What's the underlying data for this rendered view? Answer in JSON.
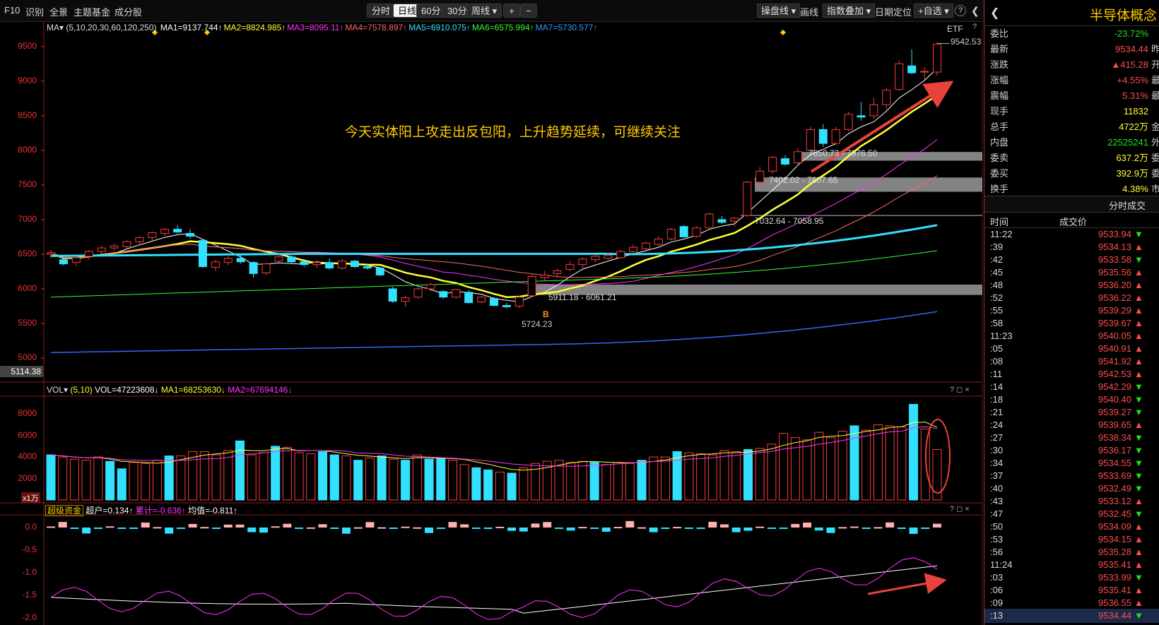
{
  "toolbar": {
    "left": [
      "F10",
      "识别",
      "全景",
      "主题基金",
      "成分股"
    ],
    "periods": [
      "分时",
      "日线",
      "60分",
      "30分",
      "周线 ▾"
    ],
    "active_period": "日线",
    "zoom_in": "+",
    "zoom_out": "−",
    "right": [
      "操盘线 ▾",
      "画线",
      "指数叠加 ▾",
      "日期定位",
      "+自选 ▾"
    ],
    "help": "?",
    "collapse": "❮"
  },
  "main_chart": {
    "ma_title": "MA▾",
    "ma_params": "(5,10,20,30,60,120,250)",
    "ma_values": [
      {
        "text": "MA1=9137.744↑",
        "color": "#ffffff"
      },
      {
        "text": "MA2=8824.985↑",
        "color": "#ffff33"
      },
      {
        "text": "MA3=8095.11↑",
        "color": "#ff33ff"
      },
      {
        "text": "MA4=7578.897↑",
        "color": "#ff6666"
      },
      {
        "text": "MA5=6910.075↑",
        "color": "#33e0ff"
      },
      {
        "text": "MA6=6575.994↑",
        "color": "#33ff33"
      },
      {
        "text": "MA7=5730.577↑",
        "color": "#3399ff"
      }
    ],
    "etf_label": "ETF",
    "help": "?",
    "y_ticks": [
      "9500",
      "9000",
      "8500",
      "8000",
      "7500",
      "7000",
      "6500",
      "6000",
      "5500",
      "5000"
    ],
    "current_price_tag": "5114.38",
    "high_label": "9542.53",
    "low_label": "5724.23",
    "buy_marker": "B",
    "annotation": "今天实体阳上攻走出反包阳，上升趋势延续，可继续关注",
    "zones": [
      {
        "label": "7850.73 - 7976.50"
      },
      {
        "label": "7402.02 - 7607.65"
      },
      {
        "label": "7032.64 - 7058.95"
      },
      {
        "label": "5911.18 - 6061.21"
      }
    ]
  },
  "vol_chart": {
    "title": "VOL▾",
    "params": "(5,10)",
    "vol_value": {
      "text": "VOL=47223608↓",
      "color": "#ffffff"
    },
    "ma1": {
      "text": "MA1=68253630↓",
      "color": "#ffff33"
    },
    "ma2": {
      "text": "MA2=67694146↓",
      "color": "#ff33ff"
    },
    "y_ticks": [
      "8000",
      "6000",
      "4000",
      "2000"
    ],
    "unit": "x1万",
    "controls": "? ◻ ×"
  },
  "fund_chart": {
    "title": "超级资金",
    "v1": {
      "text": "超户=0.134↑",
      "color": "#ffffff"
    },
    "v2": {
      "text": "累计=-0.636↑",
      "color": "#ff33ff"
    },
    "v3": {
      "text": "均值=-0.811↑",
      "color": "#ffffff"
    },
    "y_ticks": [
      "0.0",
      "-0.5",
      "-1.0",
      "-1.5",
      "-2.0"
    ],
    "controls": "? ◻ ×"
  },
  "side": {
    "title": "半导体概念",
    "quotes": [
      {
        "label": "委比",
        "value": "-23.72%",
        "color": "#20e020",
        "extra": ""
      },
      {
        "label": "最新",
        "value": "9534.44",
        "color": "#ff4d4d",
        "extra": "昨"
      },
      {
        "label": "涨跌",
        "value": "▲415.28",
        "color": "#ff4d4d",
        "extra": "开"
      },
      {
        "label": "涨幅",
        "value": "+4.55%",
        "color": "#ff4d4d",
        "extra": "最"
      },
      {
        "label": "震幅",
        "value": "5.31%",
        "color": "#ff4d4d",
        "extra": "最"
      },
      {
        "label": "现手",
        "value": "11832",
        "color": "#ffff33",
        "extra": ""
      },
      {
        "label": "总手",
        "value": "4722万",
        "color": "#ffff33",
        "extra": "金"
      },
      {
        "label": "内盘",
        "value": "22525241",
        "color": "#20e020",
        "extra": "外"
      },
      {
        "label": "委卖",
        "value": "637.2万",
        "color": "#ffff33",
        "extra": "委"
      },
      {
        "label": "委买",
        "value": "392.9万",
        "color": "#ffff33",
        "extra": "委"
      },
      {
        "label": "换手",
        "value": "4.38%",
        "color": "#ffff33",
        "extra": "市"
      }
    ],
    "trades_title": "分时成交",
    "trade_headers": [
      "时间",
      "成交价"
    ],
    "trades": [
      {
        "t": "11:22",
        "p": "9533.94",
        "d": "▼"
      },
      {
        "t": ":39",
        "p": "9534.13",
        "d": "▲"
      },
      {
        "t": ":42",
        "p": "9533.58",
        "d": "▼"
      },
      {
        "t": ":45",
        "p": "9535.56",
        "d": "▲"
      },
      {
        "t": ":48",
        "p": "9536.20",
        "d": "▲"
      },
      {
        "t": ":52",
        "p": "9536.22",
        "d": "▲"
      },
      {
        "t": ":55",
        "p": "9539.29",
        "d": "▲"
      },
      {
        "t": ":58",
        "p": "9539.67",
        "d": "▲"
      },
      {
        "t": "11:23",
        "p": "9540.05",
        "d": "▲"
      },
      {
        "t": ":05",
        "p": "9540.91",
        "d": "▲"
      },
      {
        "t": ":08",
        "p": "9541.92",
        "d": "▲"
      },
      {
        "t": ":11",
        "p": "9542.53",
        "d": "▲"
      },
      {
        "t": ":14",
        "p": "9542.29",
        "d": "▼"
      },
      {
        "t": ":18",
        "p": "9540.40",
        "d": "▼"
      },
      {
        "t": ":21",
        "p": "9539.27",
        "d": "▼"
      },
      {
        "t": ":24",
        "p": "9539.65",
        "d": "▲"
      },
      {
        "t": ":27",
        "p": "9538.34",
        "d": "▼"
      },
      {
        "t": ":30",
        "p": "9536.17",
        "d": "▼"
      },
      {
        "t": ":34",
        "p": "9534.55",
        "d": "▼"
      },
      {
        "t": ":37",
        "p": "9533.69",
        "d": "▼"
      },
      {
        "t": ":40",
        "p": "9532.49",
        "d": "▼"
      },
      {
        "t": ":43",
        "p": "9533.12",
        "d": "▲"
      },
      {
        "t": ":47",
        "p": "9532.45",
        "d": "▼"
      },
      {
        "t": ":50",
        "p": "9534.09",
        "d": "▲"
      },
      {
        "t": ":53",
        "p": "9534.15",
        "d": "▲"
      },
      {
        "t": ":56",
        "p": "9535.28",
        "d": "▲"
      },
      {
        "t": "11:24",
        "p": "9535.41",
        "d": "▲"
      },
      {
        "t": ":03",
        "p": "9533.99",
        "d": "▼"
      },
      {
        "t": ":06",
        "p": "9535.41",
        "d": "▲"
      },
      {
        "t": ":09",
        "p": "9536.55",
        "d": "▲"
      },
      {
        "t": ":13",
        "p": "9534.44",
        "d": "▼"
      }
    ]
  },
  "chart_data": {
    "type": "candlestick",
    "candles": [
      [
        6500,
        6560,
        6440,
        6520,
        "up"
      ],
      [
        6420,
        6480,
        6340,
        6360,
        "dn"
      ],
      [
        6380,
        6460,
        6330,
        6450,
        "up"
      ],
      [
        6470,
        6560,
        6420,
        6540,
        "up"
      ],
      [
        6540,
        6620,
        6500,
        6590,
        "up"
      ],
      [
        6590,
        6650,
        6550,
        6620,
        "up"
      ],
      [
        6610,
        6700,
        6580,
        6680,
        "up"
      ],
      [
        6680,
        6760,
        6640,
        6740,
        "up"
      ],
      [
        6740,
        6830,
        6700,
        6810,
        "up"
      ],
      [
        6800,
        6880,
        6760,
        6860,
        "up"
      ],
      [
        6860,
        6920,
        6800,
        6820,
        "dn"
      ],
      [
        6800,
        6860,
        6720,
        6760,
        "dn"
      ],
      [
        6700,
        6720,
        6300,
        6320,
        "dn"
      ],
      [
        6310,
        6420,
        6260,
        6390,
        "up"
      ],
      [
        6380,
        6470,
        6340,
        6440,
        "up"
      ],
      [
        6440,
        6500,
        6360,
        6390,
        "dn"
      ],
      [
        6380,
        6400,
        6160,
        6220,
        "dn"
      ],
      [
        6230,
        6380,
        6200,
        6360,
        "up"
      ],
      [
        6400,
        6500,
        6380,
        6460,
        "up"
      ],
      [
        6460,
        6480,
        6360,
        6390,
        "dn"
      ],
      [
        6390,
        6430,
        6320,
        6350,
        "dn"
      ],
      [
        6350,
        6420,
        6300,
        6380,
        "up"
      ],
      [
        6380,
        6440,
        6280,
        6300,
        "dn"
      ],
      [
        6300,
        6440,
        6280,
        6400,
        "up"
      ],
      [
        6400,
        6420,
        6300,
        6320,
        "dn"
      ],
      [
        6320,
        6360,
        6280,
        6300,
        "dn"
      ],
      [
        6300,
        6320,
        6180,
        6200,
        "dn"
      ],
      [
        6000,
        6030,
        5800,
        5820,
        "dn"
      ],
      [
        5820,
        5900,
        5740,
        5870,
        "up"
      ],
      [
        5880,
        6020,
        5860,
        6000,
        "up"
      ],
      [
        6000,
        6080,
        5960,
        6060,
        "up"
      ],
      [
        5960,
        5980,
        5860,
        5880,
        "dn"
      ],
      [
        5880,
        6000,
        5860,
        5990,
        "up"
      ],
      [
        5950,
        5980,
        5790,
        5800,
        "dn"
      ],
      [
        5810,
        5900,
        5790,
        5880,
        "up"
      ],
      [
        5860,
        5880,
        5750,
        5760,
        "dn"
      ],
      [
        5760,
        5800,
        5720,
        5740,
        "dn"
      ],
      [
        5750,
        5900,
        5724,
        5880,
        "up"
      ],
      [
        5900,
        6200,
        5890,
        6180,
        "up"
      ],
      [
        6160,
        6260,
        6120,
        6200,
        "up"
      ],
      [
        6220,
        6290,
        6160,
        6260,
        "up"
      ],
      [
        6280,
        6400,
        6250,
        6350,
        "up"
      ],
      [
        6350,
        6450,
        6300,
        6430,
        "up"
      ],
      [
        6420,
        6500,
        6380,
        6470,
        "up"
      ],
      [
        6440,
        6520,
        6420,
        6480,
        "up"
      ],
      [
        6450,
        6560,
        6440,
        6540,
        "up"
      ],
      [
        6540,
        6640,
        6520,
        6600,
        "up"
      ],
      [
        6580,
        6680,
        6560,
        6660,
        "up"
      ],
      [
        6640,
        6760,
        6620,
        6720,
        "up"
      ],
      [
        6720,
        6880,
        6700,
        6860,
        "up"
      ],
      [
        6900,
        6920,
        6740,
        6750,
        "dn"
      ],
      [
        6760,
        6900,
        6740,
        6880,
        "up"
      ],
      [
        6880,
        7100,
        6860,
        7080,
        "up"
      ],
      [
        7000,
        7050,
        6940,
        6960,
        "dn"
      ],
      [
        6980,
        7040,
        6900,
        7020,
        "up"
      ],
      [
        7060,
        7560,
        7040,
        7540,
        "up"
      ],
      [
        7540,
        7760,
        7500,
        7700,
        "up"
      ],
      [
        7700,
        7920,
        7660,
        7900,
        "up"
      ],
      [
        7880,
        7930,
        7780,
        7800,
        "dn"
      ],
      [
        7820,
        8030,
        7800,
        7980,
        "up"
      ],
      [
        8000,
        8340,
        7980,
        8300,
        "up"
      ],
      [
        8300,
        8380,
        8050,
        8100,
        "dn"
      ],
      [
        8100,
        8340,
        8080,
        8300,
        "up"
      ],
      [
        8300,
        8560,
        8280,
        8520,
        "up"
      ],
      [
        8500,
        8700,
        8430,
        8480,
        "dn"
      ],
      [
        8500,
        8760,
        8460,
        8660,
        "up"
      ],
      [
        8660,
        8900,
        8600,
        8870,
        "up"
      ],
      [
        8880,
        9300,
        8860,
        9250,
        "up"
      ],
      [
        9220,
        9460,
        9100,
        9120,
        "dn"
      ],
      [
        9130,
        9200,
        9020,
        9140,
        "up"
      ],
      [
        9130,
        9560,
        9080,
        9534,
        "up"
      ]
    ],
    "ylim": [
      5000,
      9600
    ],
    "volume": [
      [
        4200,
        "dn"
      ],
      [
        4000,
        "up"
      ],
      [
        3800,
        "up"
      ],
      [
        3700,
        "up"
      ],
      [
        4000,
        "up"
      ],
      [
        3600,
        "dn"
      ],
      [
        2900,
        "dn"
      ],
      [
        3500,
        "up"
      ],
      [
        3400,
        "up"
      ],
      [
        3700,
        "up"
      ],
      [
        4100,
        "dn"
      ],
      [
        4100,
        "up"
      ],
      [
        4500,
        "up"
      ],
      [
        4500,
        "up"
      ],
      [
        4200,
        "up"
      ],
      [
        4600,
        "up"
      ],
      [
        5500,
        "dn"
      ],
      [
        4200,
        "up"
      ],
      [
        4400,
        "up"
      ],
      [
        5000,
        "dn"
      ],
      [
        4900,
        "up"
      ],
      [
        4400,
        "up"
      ],
      [
        4300,
        "up"
      ],
      [
        4500,
        "dn"
      ],
      [
        4200,
        "dn"
      ],
      [
        4100,
        "up"
      ],
      [
        3700,
        "dn"
      ],
      [
        3900,
        "up"
      ],
      [
        4100,
        "dn"
      ],
      [
        3800,
        "up"
      ],
      [
        3700,
        "dn"
      ],
      [
        4200,
        "up"
      ],
      [
        3800,
        "dn"
      ],
      [
        3900,
        "dn"
      ],
      [
        3700,
        "up"
      ],
      [
        3300,
        "up"
      ],
      [
        3000,
        "dn"
      ],
      [
        2800,
        "dn"
      ],
      [
        2600,
        "up"
      ],
      [
        2500,
        "dn"
      ],
      [
        3000,
        "up"
      ],
      [
        3400,
        "up"
      ],
      [
        3600,
        "up"
      ],
      [
        3700,
        "up"
      ],
      [
        3500,
        "up"
      ],
      [
        3600,
        "up"
      ],
      [
        3500,
        "dn"
      ],
      [
        3300,
        "up"
      ],
      [
        3500,
        "up"
      ],
      [
        3400,
        "up"
      ],
      [
        3700,
        "dn"
      ],
      [
        4000,
        "up"
      ],
      [
        4000,
        "up"
      ],
      [
        4500,
        "dn"
      ],
      [
        4400,
        "up"
      ],
      [
        4300,
        "up"
      ],
      [
        4200,
        "up"
      ],
      [
        4600,
        "up"
      ],
      [
        4500,
        "up"
      ],
      [
        4700,
        "dn"
      ],
      [
        4800,
        "up"
      ],
      [
        5200,
        "up"
      ],
      [
        6200,
        "up"
      ],
      [
        5800,
        "up"
      ],
      [
        5600,
        "up"
      ],
      [
        6300,
        "up"
      ],
      [
        5800,
        "up"
      ],
      [
        6400,
        "up"
      ],
      [
        6900,
        "dn"
      ],
      [
        6500,
        "up"
      ],
      [
        7000,
        "up"
      ],
      [
        6900,
        "up"
      ],
      [
        6800,
        "up"
      ],
      [
        8900,
        "dn"
      ],
      [
        6600,
        "up"
      ],
      [
        4700,
        "up"
      ]
    ],
    "vol_ylim": [
      0,
      9000
    ],
    "fund_ylim": [
      -2.1,
      0.25
    ]
  }
}
